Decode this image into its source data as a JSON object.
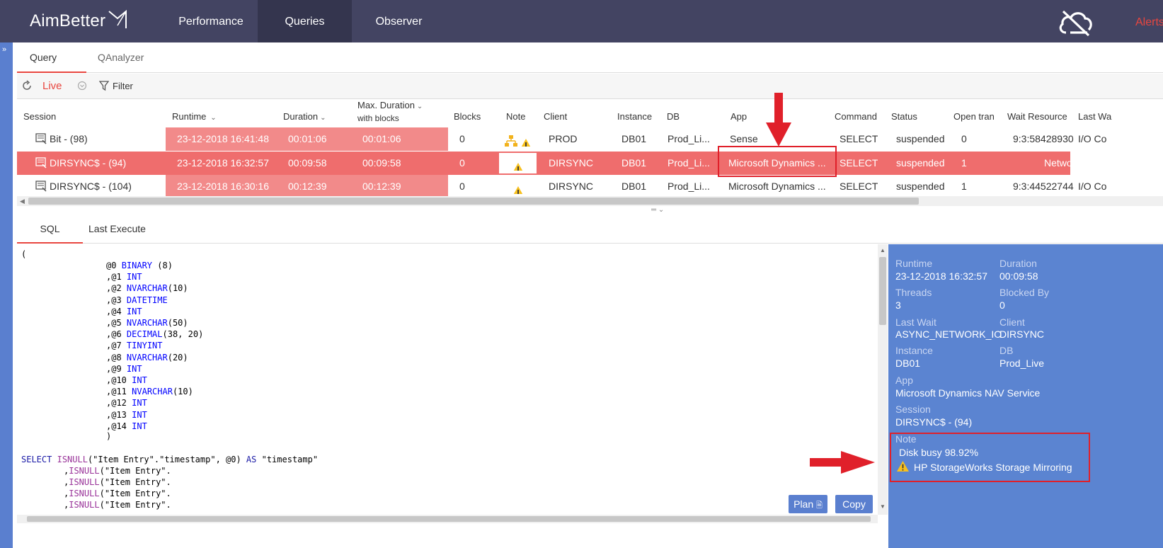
{
  "topbar": {
    "logo": "AimBetter",
    "nav": [
      "Performance",
      "Queries",
      "Observer"
    ],
    "active_nav": "Queries",
    "alerts": "Alerts",
    "icons": {
      "cloud": "cloud-off-icon"
    }
  },
  "subtabs": [
    "Query Live",
    "QAnalyzer"
  ],
  "toolbar": {
    "live": "Live",
    "filter": "Filter"
  },
  "grid": {
    "headers": {
      "session": "Session",
      "runtime": "Runtime",
      "duration": "Duration",
      "max_duration": "Max. Duration",
      "max_duration_sub": "with blocks",
      "blocks": "Blocks",
      "note": "Note",
      "client": "Client",
      "instance": "Instance",
      "db": "DB",
      "app": "App",
      "command": "Command",
      "status": "Status",
      "open_tran": "Open tran",
      "wait_resource": "Wait Resource",
      "last_wait": "Last Wa"
    },
    "rows": [
      {
        "session": "Bit - (98)",
        "runtime": "23-12-2018 16:41:48",
        "duration": "00:01:06",
        "max_duration": "00:01:06",
        "blocks": "0",
        "client": "PROD",
        "instance": "DB01",
        "db": "Prod_Li...",
        "app": "Sense",
        "command": "SELECT",
        "status": "suspended",
        "open_tran": "0",
        "wait_resource": "9:3:58428930",
        "last_wait": "I/O Co"
      },
      {
        "session": "DIRSYNC$ - (94)",
        "runtime": "23-12-2018 16:32:57",
        "duration": "00:09:58",
        "max_duration": "00:09:58",
        "blocks": "0",
        "client": "DIRSYNC",
        "instance": "DB01",
        "db": "Prod_Li...",
        "app": "Microsoft Dynamics ...",
        "command": "SELECT",
        "status": "suspended",
        "open_tran": "1",
        "wait_resource": "Netwo",
        "last_wait": ""
      },
      {
        "session": "DIRSYNC$ - (104)",
        "runtime": "23-12-2018 16:30:16",
        "duration": "00:12:39",
        "max_duration": "00:12:39",
        "blocks": "0",
        "client": "DIRSYNC",
        "instance": "DB01",
        "db": "Prod_Li...",
        "app": "Microsoft Dynamics ...",
        "command": "SELECT",
        "status": "suspended",
        "open_tran": "1",
        "wait_resource": "9:3:44522744",
        "last_wait": "I/O Co"
      }
    ]
  },
  "lowtabs": [
    "SQL",
    "Last Execute"
  ],
  "code": {
    "params": [
      {
        "name": "@0",
        "type": "BINARY",
        "args": " (8)"
      },
      {
        "name": ",@1",
        "type": "INT",
        "args": ""
      },
      {
        "name": ",@2",
        "type": "NVARCHAR",
        "args": "(10)"
      },
      {
        "name": ",@3",
        "type": "DATETIME",
        "args": ""
      },
      {
        "name": ",@4",
        "type": "INT",
        "args": ""
      },
      {
        "name": ",@5",
        "type": "NVARCHAR",
        "args": "(50)"
      },
      {
        "name": ",@6",
        "type": "DECIMAL",
        "args": "(38, 20)"
      },
      {
        "name": ",@7",
        "type": "TINYINT",
        "args": ""
      },
      {
        "name": ",@8",
        "type": "NVARCHAR",
        "args": "(20)"
      },
      {
        "name": ",@9",
        "type": "INT",
        "args": ""
      },
      {
        "name": ",@10",
        "type": "INT",
        "args": ""
      },
      {
        "name": ",@11",
        "type": "NVARCHAR",
        "args": "(10)"
      },
      {
        "name": ",@12",
        "type": "INT",
        "args": ""
      },
      {
        "name": ",@13",
        "type": "INT",
        "args": ""
      },
      {
        "name": ",@14",
        "type": "INT",
        "args": ""
      }
    ],
    "open": "(",
    "close": ")",
    "select_kw": "SELECT",
    "isnull_fn": "ISNULL",
    "select_rest": "(\"Item Entry\".\"timestamp\", @0) ",
    "as_kw": "AS",
    "select_alias": " \"timestamp\"",
    "cont_prefix": ",",
    "cont_rest": "(\"Item Entry\"."
  },
  "buttons": {
    "plan": "Plan",
    "copy": "Copy"
  },
  "detail": {
    "runtime_label": "Runtime",
    "runtime": "23-12-2018 16:32:57",
    "duration_label": "Duration",
    "duration": "00:09:58",
    "threads_label": "Threads",
    "threads": "3",
    "blocked_by_label": "Blocked By",
    "blocked_by": "0",
    "last_wait_label": "Last Wait",
    "last_wait": "ASYNC_NETWORK_IO",
    "client_label": "Client",
    "client": "DIRSYNC",
    "instance_label": "Instance",
    "instance": "DB01",
    "db_label": "DB",
    "db": "Prod_Live",
    "app_label": "App",
    "app": "Microsoft Dynamics NAV Service",
    "session_label": "Session",
    "session": "DIRSYNC$ - (94)",
    "note_label": "Note",
    "note_line1": "Disk busy 98.92%",
    "note_line2": "HP StorageWorks Storage Mirroring"
  },
  "colors": {
    "nav_bg": "#434462",
    "accent_red": "#e8463f",
    "row_highlight": "#ef6d6d",
    "time_cell": "#f28a8a",
    "panel_blue": "#5b84d1"
  }
}
